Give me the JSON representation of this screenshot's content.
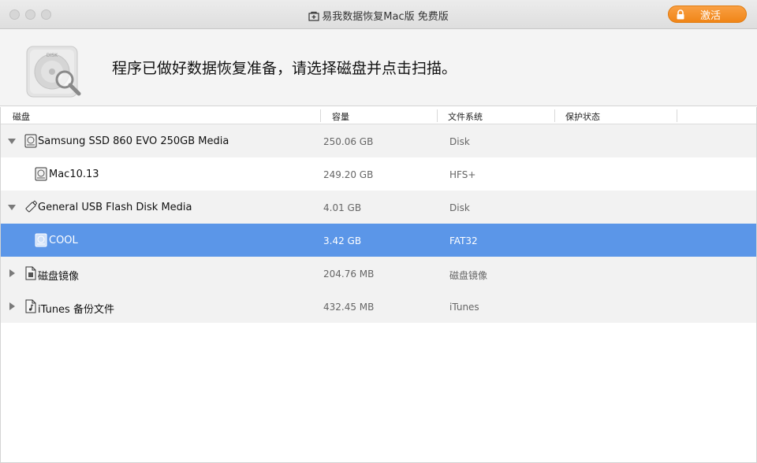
{
  "window": {
    "title": "易我数据恢复Mac版 免费版",
    "activate_label": "激活"
  },
  "header": {
    "headline": "程序已做好数据恢复准备，请选择磁盘并点击扫描。",
    "disk_label": "DISK"
  },
  "columns": {
    "disk": "磁盘",
    "capacity": "容量",
    "filesystem": "文件系统",
    "protection": "保护状态"
  },
  "rows": [
    {
      "name": "Samsung SSD 860 EVO 250GB Media",
      "capacity": "250.06 GB",
      "fs": "Disk",
      "icon": "hard-drive-icon",
      "expander": "expanded"
    },
    {
      "name": "Mac10.13",
      "capacity": "249.20 GB",
      "fs": "HFS+",
      "icon": "volume-icon",
      "expander": "none"
    },
    {
      "name": "General USB Flash Disk Media",
      "capacity": "4.01 GB",
      "fs": "Disk",
      "icon": "usb-drive-icon",
      "expander": "expanded"
    },
    {
      "name": "COOL",
      "capacity": "3.42 GB",
      "fs": "FAT32",
      "icon": "volume-icon",
      "expander": "none",
      "selected": true
    },
    {
      "name": "磁盘镜像",
      "capacity": "204.76 MB",
      "fs": "磁盘镜像",
      "icon": "disk-image-icon",
      "expander": "collapsed"
    },
    {
      "name": "iTunes 备份文件",
      "capacity": "432.45 MB",
      "fs": "iTunes",
      "icon": "itunes-backup-icon",
      "expander": "collapsed"
    }
  ],
  "colors": {
    "accent_orange": "#f08517",
    "selection_blue": "#5b96e8"
  }
}
